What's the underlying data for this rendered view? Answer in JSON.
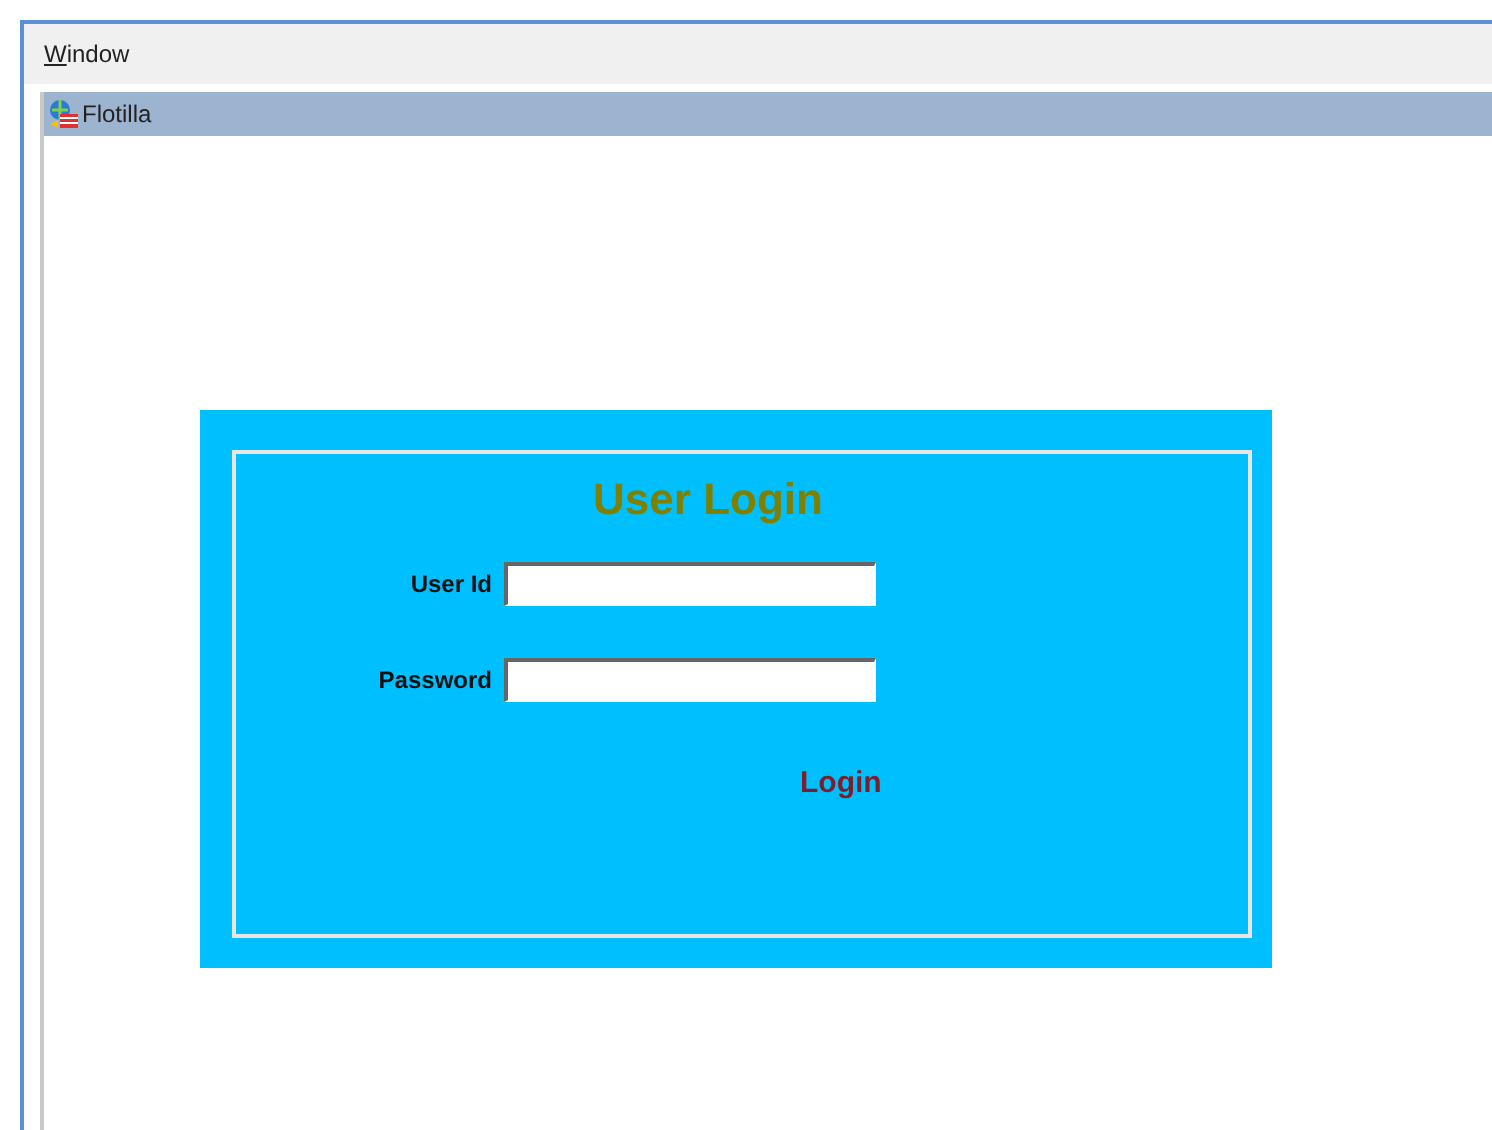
{
  "menu_bar": {
    "items": [
      {
        "label": "Window"
      }
    ]
  },
  "window": {
    "title": "Flotilla"
  },
  "login": {
    "title": "User Login",
    "fields": [
      {
        "label": "User Id"
      },
      {
        "label": "Password"
      }
    ],
    "button": "Login"
  }
}
